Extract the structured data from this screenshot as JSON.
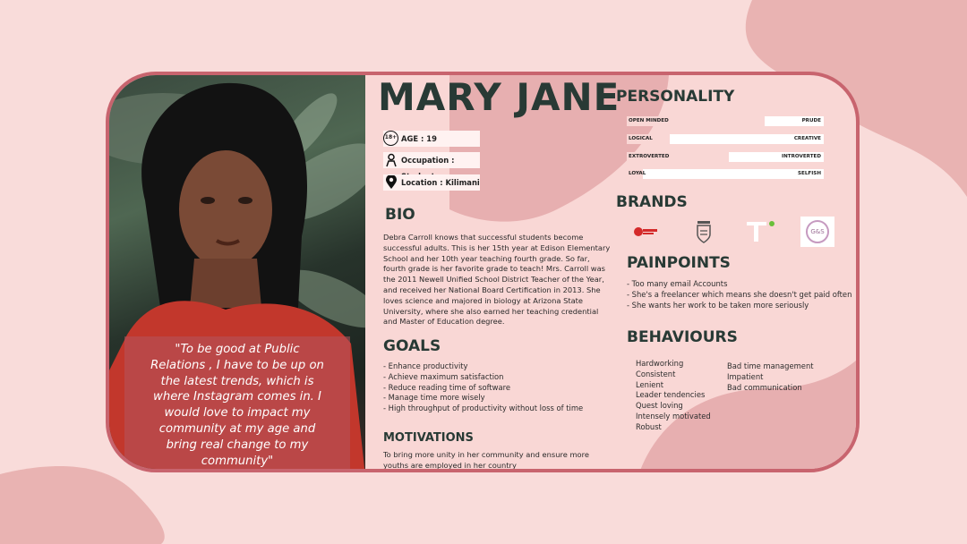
{
  "persona": {
    "name": "MARY JANE",
    "quote": "\"To be good at Public Relations , I have to be up on the latest trends, which is where Instagram comes in. I would love to impact my community at my age and bring real change to my community\"",
    "age_label": "AGE : 19",
    "age_icon": "18+",
    "occupation_label": "Occupation : Student",
    "location_label": "Location : Kilimani"
  },
  "bio": {
    "heading": "BIO",
    "text": "Debra Carroll knows that successful students become successful adults. This is her 15th year at Edison Elementary School and her 10th year teaching fourth grade. So far, fourth grade is her favorite grade to teach! Mrs. Carroll was the 2011 Newell Unified School District Teacher of the Year, and received her National Board Certification in 2013. She loves science and majored in biology at Arizona State University, where she also earned her teaching credential and Master of Education degree."
  },
  "goals": {
    "heading": "GOALS",
    "items": [
      "- Enhance productivity",
      "- Achieve maximum satisfaction",
      "- Reduce reading time of software",
      "- Manage time more wisely",
      "- High throughput of productivity without loss of time"
    ]
  },
  "motivations": {
    "heading": "MOTIVATIONS",
    "text": "To bring more unity in her community and ensure more youths are employed in her country"
  },
  "personality": {
    "heading": "PERSONALITY",
    "traits": [
      {
        "left": "OPEN MINDED",
        "right": "PRUDE",
        "level": 0.7
      },
      {
        "left": "LOGICAL",
        "right": "CREATIVE",
        "level": 0.22
      },
      {
        "left": "EXTROVERTED",
        "right": "INTROVERTED",
        "level": 0.52
      },
      {
        "left": "LOYAL",
        "right": "SELFISH",
        "level": 0.08
      }
    ]
  },
  "brands": {
    "heading": "BRANDS",
    "logos": [
      "red-brand-logo",
      "shield-brand-logo",
      "t-brand-logo",
      "g-and-s-brand-logo"
    ],
    "gs_text": "G&S"
  },
  "painpoints": {
    "heading": "PAINPOINTS",
    "items": [
      "- Too many email Accounts",
      "- She's a freelancer which means she doesn't get paid often",
      "- She wants her work to be taken more seriously"
    ]
  },
  "behaviours": {
    "heading": "BEHAVIOURS",
    "col1": [
      "Hardworking",
      "Consistent",
      "Lenient",
      "Leader tendencies",
      "Quest loving",
      "Intensely motivated",
      "Robust"
    ],
    "col2": [
      "Bad time management",
      "Impatient",
      "Bad communication"
    ]
  },
  "colors": {
    "background": "#f9dcda",
    "card_border": "#c8646e",
    "heading": "#283a35",
    "blob": "#e9b3b2"
  }
}
